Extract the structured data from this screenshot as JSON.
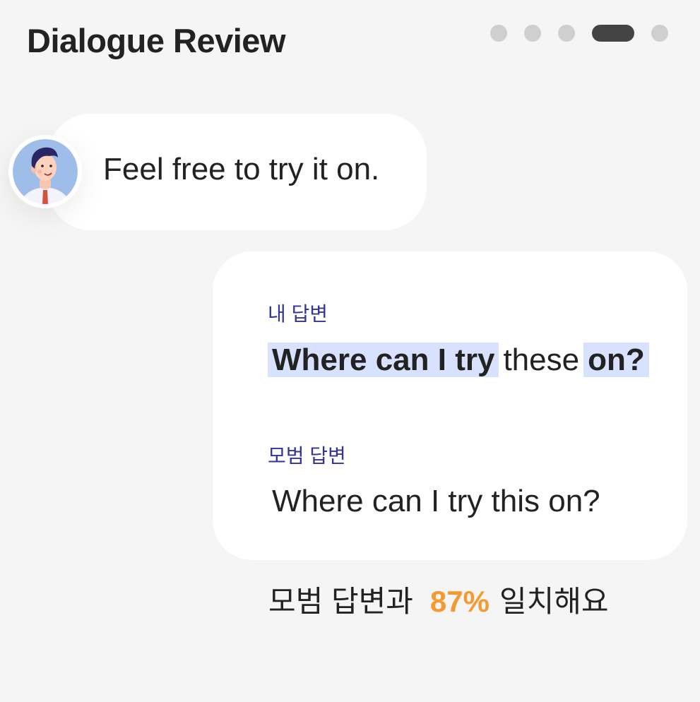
{
  "header": {
    "title": "Dialogue Review"
  },
  "pagination": {
    "total": 5,
    "current": 4
  },
  "ai_message": {
    "text": "Feel free to try it on.",
    "avatar_icon": "man-avatar-icon"
  },
  "my_answer": {
    "label": "내 답변",
    "segments": [
      {
        "text": "Where can I try",
        "highlighted": true
      },
      {
        "text": "these",
        "highlighted": false
      },
      {
        "text": "on?",
        "highlighted": true
      }
    ]
  },
  "model_answer": {
    "label": "모범 답변",
    "text": "Where can I try this on?"
  },
  "summary": {
    "prefix": "모범 답변과",
    "percent": "87%",
    "suffix": "일치해요"
  },
  "colors": {
    "accent": "#f59a2e",
    "label": "#33339a",
    "highlight": "#d8e2ff",
    "active_dot": "#444444"
  }
}
